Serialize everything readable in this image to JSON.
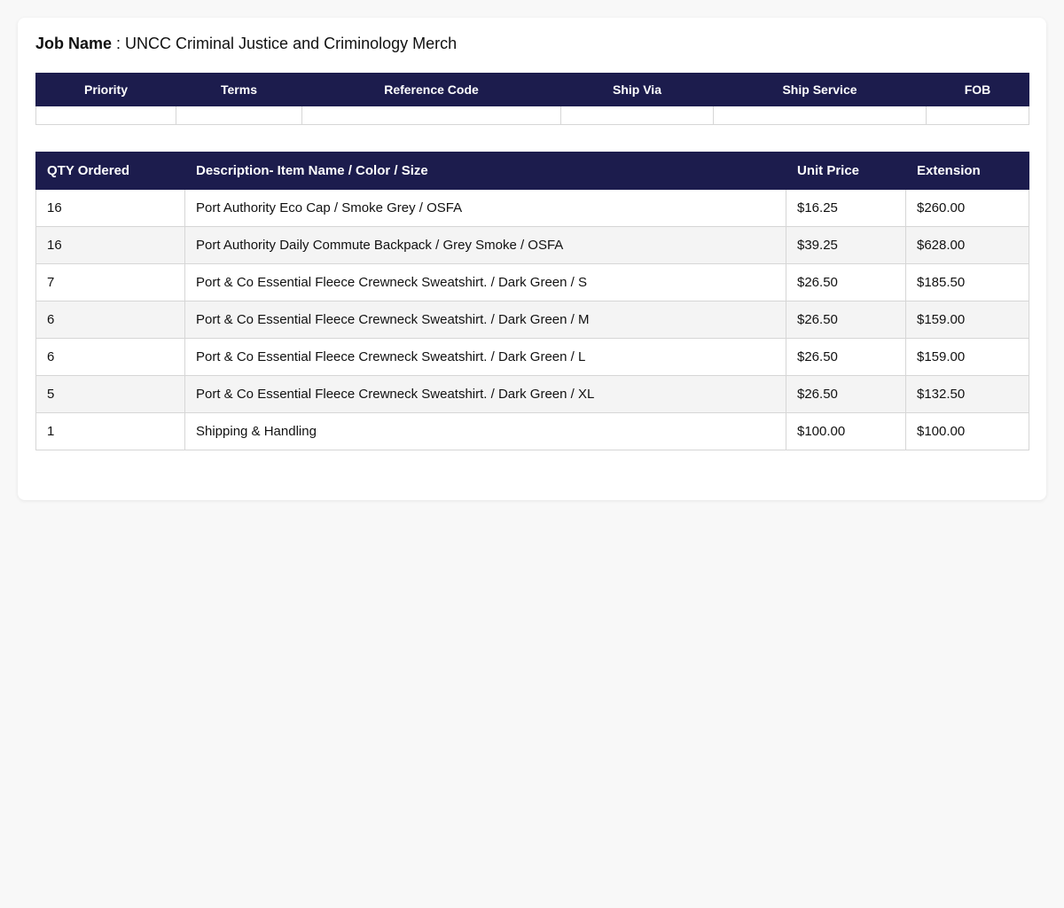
{
  "job": {
    "label": "Job Name",
    "separator": " : ",
    "value": "UNCC Criminal Justice and Criminology Merch"
  },
  "meta": {
    "headers": [
      "Priority",
      "Terms",
      "Reference Code",
      "Ship Via",
      "Ship Service",
      "FOB"
    ],
    "values": [
      "",
      "",
      "",
      "",
      "",
      ""
    ]
  },
  "items": {
    "headers": [
      "QTY Ordered",
      "Description- Item Name / Color / Size",
      "Unit Price",
      "Extension"
    ],
    "rows": [
      [
        "16",
        "Port Authority Eco Cap / Smoke Grey / OSFA",
        "$16.25",
        "$260.00"
      ],
      [
        "16",
        "Port Authority Daily Commute Backpack / Grey Smoke / OSFA",
        "$39.25",
        "$628.00"
      ],
      [
        "7",
        "Port & Co Essential Fleece Crewneck Sweatshirt. / Dark Green / S",
        "$26.50",
        "$185.50"
      ],
      [
        "6",
        "Port & Co Essential Fleece Crewneck Sweatshirt. / Dark Green / M",
        "$26.50",
        "$159.00"
      ],
      [
        "6",
        "Port & Co Essential Fleece Crewneck Sweatshirt. / Dark Green / L",
        "$26.50",
        "$159.00"
      ],
      [
        "5",
        "Port & Co Essential Fleece Crewneck Sweatshirt. / Dark Green / XL",
        "$26.50",
        "$132.50"
      ],
      [
        "1",
        "Shipping & Handling",
        "$100.00",
        "$100.00"
      ]
    ]
  },
  "colors": {
    "header_bg": "#1c1c4d",
    "header_text": "#ffffff",
    "alt_row": "#f4f4f4",
    "border": "#d6d6d6"
  }
}
